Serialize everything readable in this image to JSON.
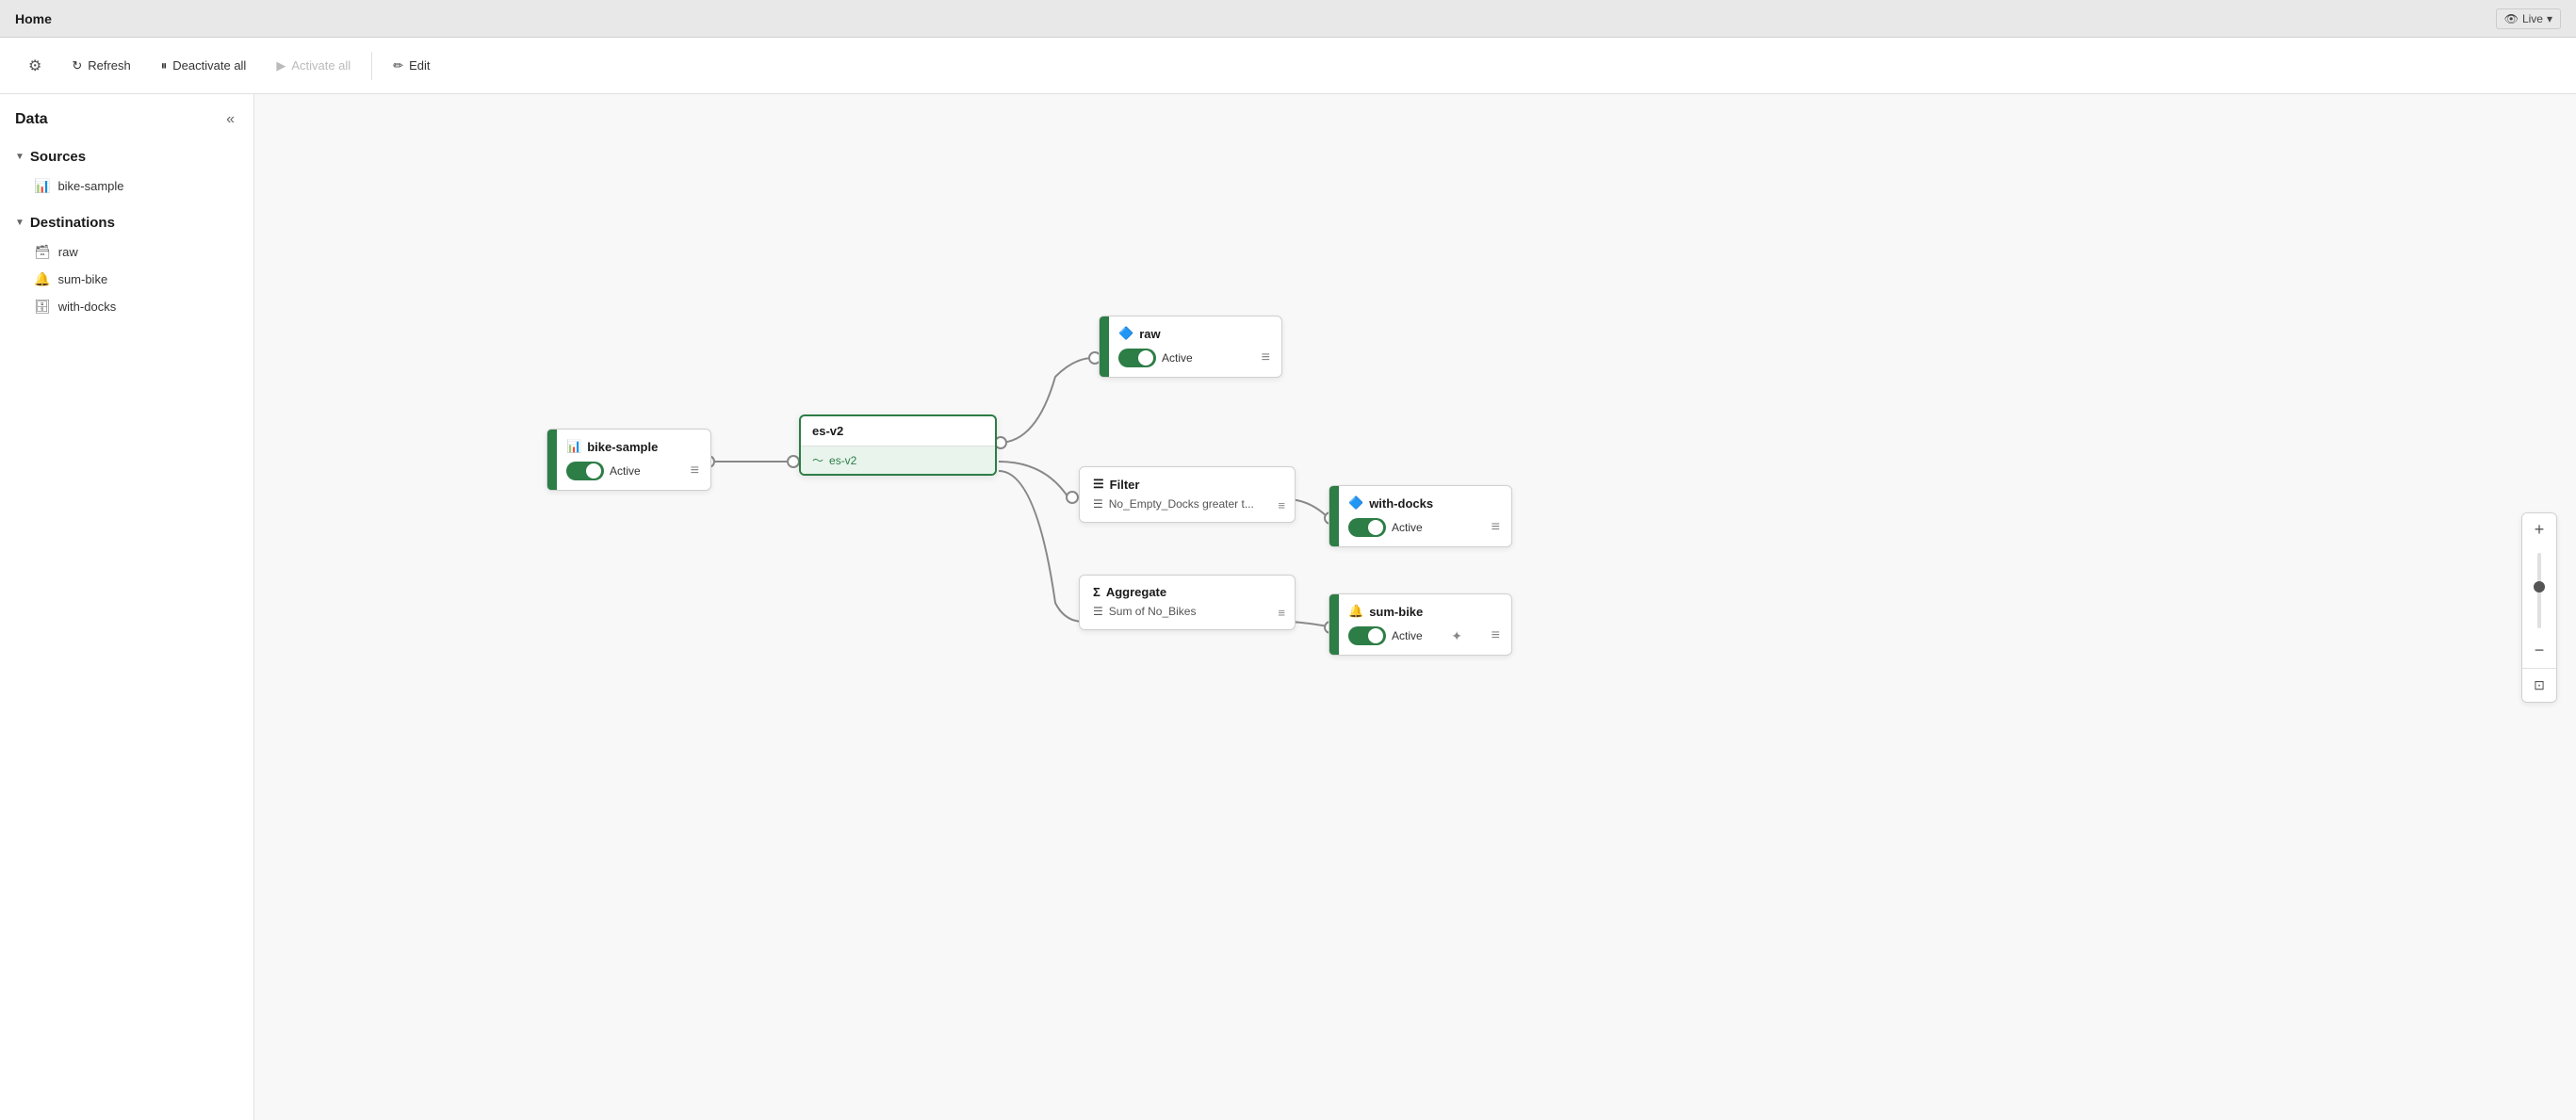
{
  "titleBar": {
    "title": "Home",
    "liveLabel": "Live"
  },
  "toolbar": {
    "settingsIcon": "⚙",
    "refreshLabel": "Refresh",
    "deactivateLabel": "Deactivate all",
    "activateLabel": "Activate all",
    "editLabel": "Edit"
  },
  "sidebar": {
    "title": "Data",
    "collapseIcon": "«",
    "sections": [
      {
        "label": "Sources",
        "expanded": true,
        "items": [
          {
            "label": "bike-sample",
            "icon": "📊"
          }
        ]
      },
      {
        "label": "Destinations",
        "expanded": true,
        "items": [
          {
            "label": "raw",
            "icon": "🗃"
          },
          {
            "label": "sum-bike",
            "icon": "🔔"
          },
          {
            "label": "with-docks",
            "icon": "🗄"
          }
        ]
      }
    ]
  },
  "canvas": {
    "nodes": {
      "source": {
        "title": "bike-sample",
        "status": "Active",
        "toggleOn": true
      },
      "connector": {
        "title": "es-v2",
        "subtitle": "es-v2"
      },
      "destRaw": {
        "title": "raw",
        "status": "Active",
        "toggleOn": true
      },
      "filterNode": {
        "title": "Filter",
        "condition": "No_Empty_Docks greater t..."
      },
      "destWithDocks": {
        "title": "with-docks",
        "status": "Active",
        "toggleOn": true
      },
      "aggregateNode": {
        "title": "Aggregate",
        "formula": "Sum of No_Bikes"
      },
      "destSumBike": {
        "title": "sum-bike",
        "status": "Active",
        "toggleOn": true
      }
    }
  },
  "zoom": {
    "plusIcon": "+",
    "minusIcon": "−",
    "fitIcon": "⊡"
  }
}
